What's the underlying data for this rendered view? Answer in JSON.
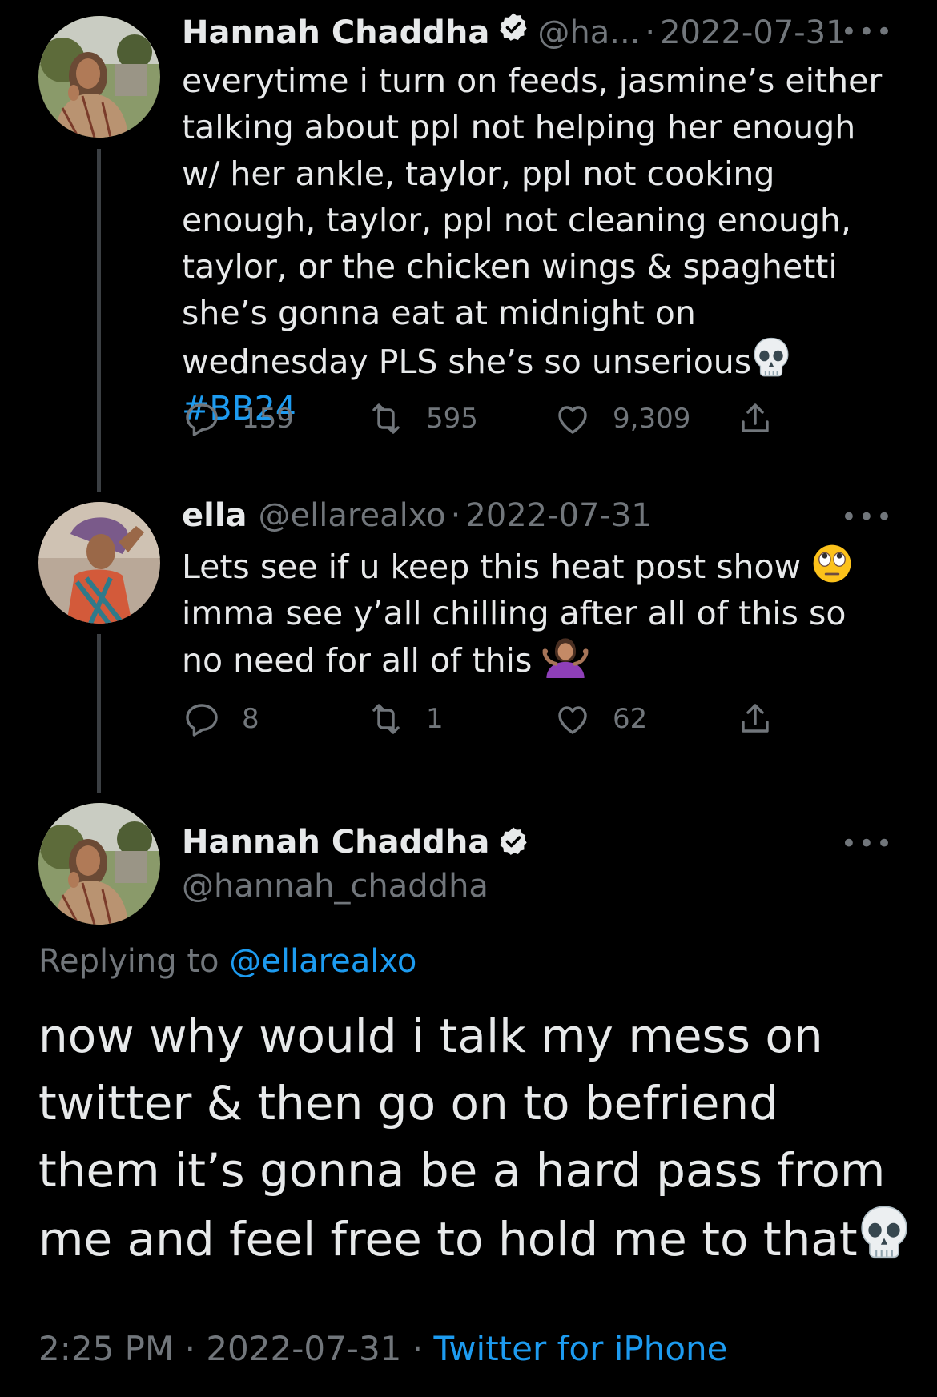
{
  "tweets": [
    {
      "name": "Hannah Chaddha",
      "verified": true,
      "handle": "@ha...",
      "sep": "·",
      "date": "2022-07-31",
      "more": "•••",
      "text": "everytime i turn on feeds, jasmine’s either talking about ppl not helping her enough w/ her ankle, taylor, ppl not cooking enough, taylor, ppl not cleaning enough, taylor, or the chicken wings & spaghetti she’s gonna eat at midnight on wednesday PLS she’s so unserious",
      "emoji": "skull",
      "hashtag": "#BB24",
      "replies": "159",
      "retweets": "595",
      "likes": "9,309"
    },
    {
      "name": "ella",
      "verified": false,
      "handle": "@ellarealxo",
      "sep": "·",
      "date": "2022-07-31",
      "more": "•••",
      "text_line1": "Lets see if u keep this heat post show",
      "text_rest": "imma see y’all chilling  after all of this so no need for all of this",
      "emoji1": "face-with-rolling-eyes",
      "emoji2": "person-shrugging",
      "replies": "8",
      "retweets": "1",
      "likes": "62"
    }
  ],
  "main": {
    "name": "Hannah Chaddha",
    "handle": "@hannah_chaddha",
    "more": "•••",
    "replying_prefix": "Replying to",
    "replying_handle": "@ellarealxo",
    "text": "now why would i talk my mess on twitter & then go on to befriend them it’s gonna be a hard pass from me and feel free to hold me to that",
    "emoji": "skull",
    "time": "2:25 PM",
    "sep": "·",
    "date": "2022-07-31",
    "sep2": "·",
    "source": "Twitter for iPhone"
  },
  "colors": {
    "background": "#000000",
    "text": "#e7e9ea",
    "muted": "#71767b",
    "link": "#1d9bf0"
  },
  "icons": [
    "reply-icon",
    "retweet-icon",
    "like-icon",
    "share-icon",
    "verified-badge-icon",
    "more-icon"
  ]
}
